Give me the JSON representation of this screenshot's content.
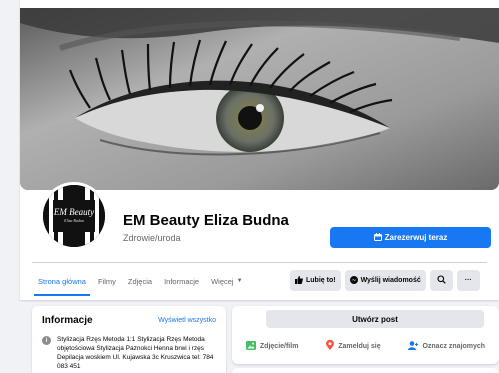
{
  "page": {
    "name": "EM Beauty Eliza Budna",
    "category": "Zdrowie/uroda",
    "avatar_logo_text": "EM Beauty",
    "avatar_logo_subtext": "Eliza Budna"
  },
  "book_button": {
    "label": "Zarezerwuj teraz",
    "icon": "calendar-icon"
  },
  "tabs": [
    {
      "label": "Strona główna",
      "active": true
    },
    {
      "label": "Filmy",
      "active": false
    },
    {
      "label": "Zdjęcia",
      "active": false
    },
    {
      "label": "Informacje",
      "active": false
    },
    {
      "label": "Więcej",
      "active": false,
      "dropdown": true
    }
  ],
  "actions": {
    "like": {
      "label": "Lubię to!",
      "icon": "thumbs-up-icon"
    },
    "message": {
      "label": "Wyślij wiadomość",
      "icon": "messenger-icon"
    },
    "search": {
      "icon": "search-icon"
    },
    "more": {
      "icon": "more-icon",
      "label": "···"
    }
  },
  "info": {
    "title": "Informacje",
    "see_all": "Wyświetl wszystko",
    "icon": "info-icon",
    "text": "Stylizacja Rzęs Metoda 1:1 Stylizacja Rzęs Metoda objętościowa Stylizacja Paznokci Henna brwi i rzęs Depilacja woskiem Ul. Kujawska 3c Kruszwica tel: 784 083 451"
  },
  "create_post": {
    "button_label": "Utwórz post",
    "actions": [
      {
        "label": "Zdjęcie/film",
        "icon": "photo-icon",
        "color": "#45bd62"
      },
      {
        "label": "Zamelduj się",
        "icon": "location-pin-icon",
        "color": "#f5533d"
      },
      {
        "label": "Oznacz znajomych",
        "icon": "tag-friends-icon",
        "color": "#1877f2"
      }
    ]
  },
  "colors": {
    "accent": "#1877f2",
    "background": "#f0f2f5",
    "secondary_text": "#65676b"
  }
}
